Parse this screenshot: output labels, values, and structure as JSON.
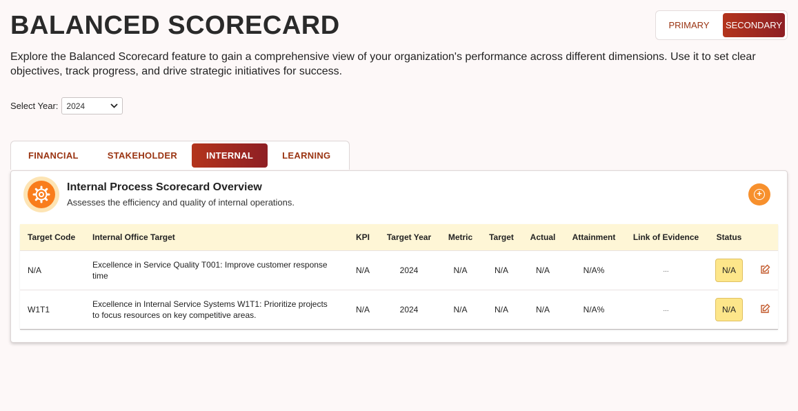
{
  "header": {
    "title": "BALANCED SCORECARD",
    "toggle": {
      "primary_label": "PRIMARY",
      "secondary_label": "SECONDARY",
      "active": "secondary"
    }
  },
  "description": "Explore the Balanced Scorecard feature to gain a comprehensive view of your organization's performance across different dimensions. Use it to set clear objectives, track progress, and drive strategic initiatives for success.",
  "year_select": {
    "label": "Select Year:",
    "value": "2024"
  },
  "tabs": [
    {
      "label": "FINANCIAL",
      "active": false
    },
    {
      "label": "STAKEHOLDER",
      "active": false
    },
    {
      "label": "INTERNAL",
      "active": true
    },
    {
      "label": "LEARNING",
      "active": false
    }
  ],
  "card": {
    "icon": "gear-icon",
    "title": "Internal Process Scorecard Overview",
    "subtitle": "Assesses the efficiency and quality of internal operations.",
    "add_icon": "plus-circle-icon"
  },
  "table": {
    "headers": [
      "Target Code",
      "Internal Office Target",
      "KPI",
      "Target Year",
      "Metric",
      "Target",
      "Actual",
      "Attainment",
      "Link of Evidence",
      "Status"
    ],
    "rows": [
      {
        "code": "N/A",
        "target": "Excellence in Service Quality T001: Improve customer response time",
        "kpi": "N/A",
        "year": "2024",
        "metric": "N/A",
        "target_value": "N/A",
        "actual": "N/A",
        "attainment": "N/A%",
        "evidence": "...",
        "status": "N/A"
      },
      {
        "code": "W1T1",
        "target": "Excellence in Internal Service Systems W1T1: Prioritize projects to focus resources on key competitive areas.",
        "kpi": "N/A",
        "year": "2024",
        "metric": "N/A",
        "target_value": "N/A",
        "actual": "N/A",
        "attainment": "N/A%",
        "evidence": "...",
        "status": "N/A"
      }
    ]
  },
  "colors": {
    "accent": "#9a3412",
    "active_gradient_start": "#b3341c",
    "active_gradient_end": "#8e1f24",
    "table_header_bg": "#fef6d6",
    "status_badge_bg": "#fde68a",
    "icon_orange": "#f97d1c"
  }
}
